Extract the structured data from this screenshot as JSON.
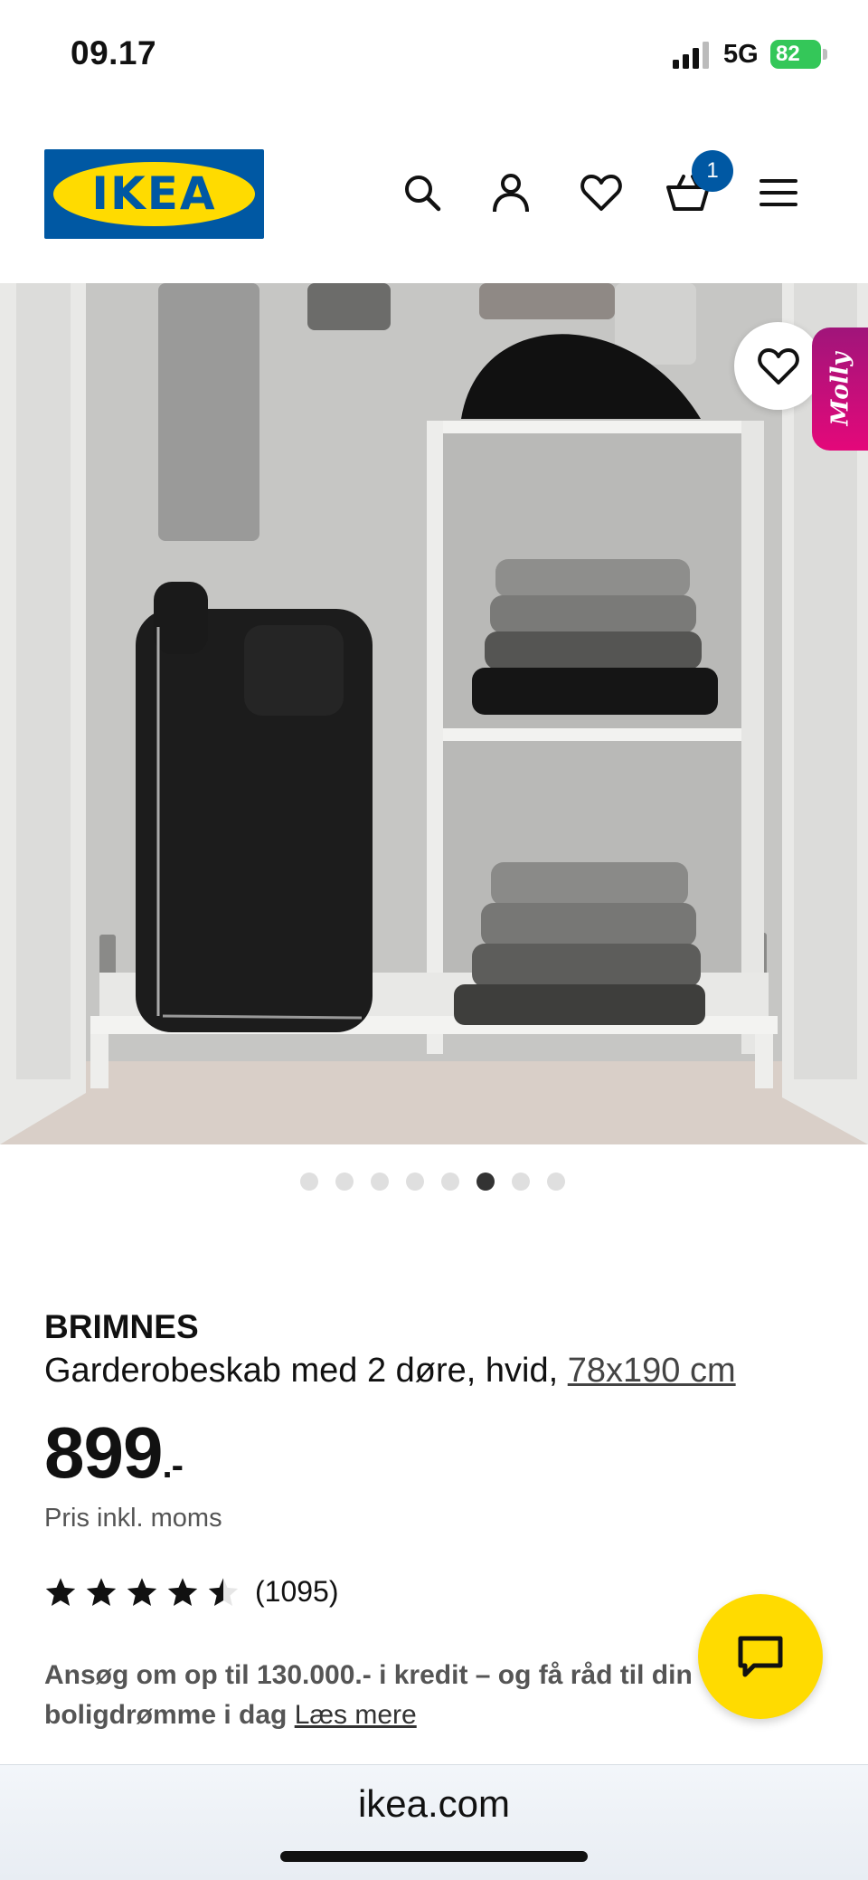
{
  "status_bar": {
    "time": "09.17",
    "network": "5G",
    "battery": "82"
  },
  "header": {
    "logo_text": "IKEA",
    "cart_count": "1",
    "icons": [
      "search-icon",
      "account-icon",
      "heart-icon",
      "cart-icon",
      "menu-icon"
    ]
  },
  "gallery": {
    "total_images": 8,
    "active_index": 5,
    "assistant_tab": "Molly"
  },
  "product": {
    "brand": "BRIMNES",
    "description": "Garderobeskab med 2 døre, hvid, ",
    "size": "78x190 cm",
    "price": "899",
    "price_suffix": ".-",
    "vat_note": "Pris inkl. moms",
    "rating": 4.5,
    "rating_count": "(1095)",
    "credit_text": "Ansøg om op til 130.000.- i kredit – og få råd til din boligdrømme i dag ",
    "credit_link": "Læs mere"
  },
  "browser": {
    "url": "ikea.com"
  },
  "colors": {
    "ikea_blue": "#0058a3",
    "ikea_yellow": "#ffdb00",
    "battery_green": "#34c759",
    "molly_magenta": "#c0107a"
  }
}
